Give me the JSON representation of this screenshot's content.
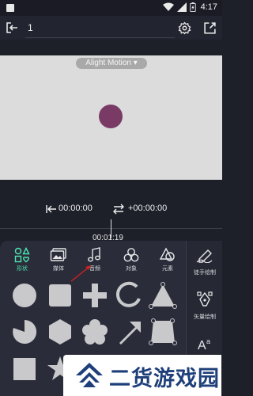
{
  "status_bar": {
    "time": "4:17"
  },
  "header": {
    "project_name": "1"
  },
  "preview": {
    "watermark": "Alight Motion ▾",
    "object_color": "#7a3a66"
  },
  "timeline": {
    "start_time": "00:00:00",
    "duration": "+00:00:00",
    "current_time": "00:01:19"
  },
  "tabs": [
    {
      "label": "形状",
      "icon": "shapes-icon",
      "active": true
    },
    {
      "label": "媒体",
      "icon": "media-icon",
      "active": false
    },
    {
      "label": "音频",
      "icon": "audio-icon",
      "active": false
    },
    {
      "label": "对象",
      "icon": "object-icon",
      "active": false
    },
    {
      "label": "元素",
      "icon": "element-icon",
      "active": false
    }
  ],
  "side_tools": [
    {
      "label": "徒手绘制",
      "icon": "freehand-draw-icon"
    },
    {
      "label": "矢量绘制",
      "icon": "vector-draw-icon"
    },
    {
      "label": "文本",
      "icon": "text-icon"
    }
  ],
  "shapes": [
    "circle",
    "square",
    "plus",
    "arc",
    "triangle",
    "pie",
    "hexagon",
    "flower",
    "arrow",
    "trapezoid",
    "square-small",
    "star"
  ],
  "banner": {
    "text": "二货游戏园"
  },
  "colors": {
    "accent": "#4de6b3",
    "panel": "#2a2d39",
    "shape": "#c9c9cc",
    "annotation_arrow": "#d32020"
  }
}
